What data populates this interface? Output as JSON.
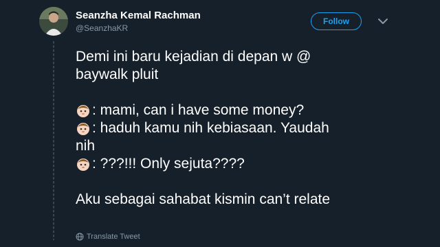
{
  "tweet": {
    "author_name": "Seanzha Kemal Rachman",
    "author_handle": "@SeanzhaKR",
    "follow_label": "Follow",
    "lines": {
      "l1": "Demi ini baru kejadian di depan w @",
      "l2": "baywalk pluit",
      "l3": ": mami, can i have some money?",
      "l4": ": haduh kamu nih kebiasaan. Yaudah",
      "l5": "nih",
      "l6": ": ???!!! Only sejuta????",
      "l7": "Aku sebagai sahabat kismin can’t relate"
    },
    "translate_label": "Translate Tweet"
  },
  "colors": {
    "background": "#15202b",
    "accent": "#1da1f2",
    "secondary_text": "#8899a6"
  },
  "icons": {
    "avatar": "avatar-photo",
    "caret": "chevron-down-icon",
    "emoji": "baby-face-emoji",
    "globe": "globe-icon"
  }
}
